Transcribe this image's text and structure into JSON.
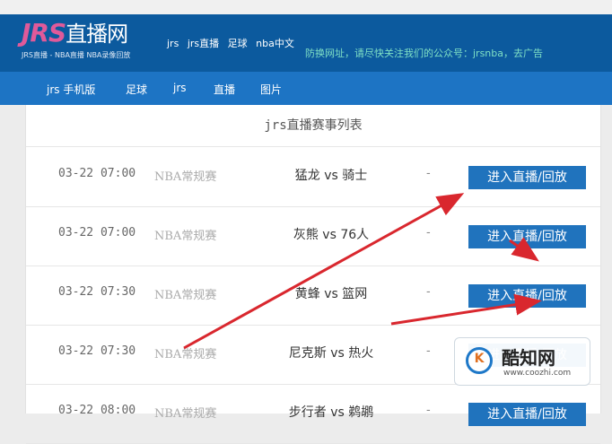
{
  "header": {
    "logo_jrs": "JRS",
    "logo_zh": "直播网",
    "logo_sub": "JRS直播 - NBA直播 NBA录像回放",
    "links": [
      "jrs",
      "jrs直播",
      "足球",
      "nba中文"
    ],
    "notice": "防换网址，请尽快关注我们的公众号：jrsnba，去广告"
  },
  "nav": {
    "items": [
      "jrs 手机版",
      "足球",
      "jrs",
      "直播",
      "图片"
    ]
  },
  "list": {
    "title": "jrs直播赛事列表",
    "button_label": "进入直播/回放",
    "rows": [
      {
        "time": "03-22 07:00",
        "league": "NBA常规赛",
        "match": "猛龙 vs 骑士",
        "score": "-"
      },
      {
        "time": "03-22 07:00",
        "league": "NBA常规赛",
        "match": "灰熊 vs 76人",
        "score": "-"
      },
      {
        "time": "03-22 07:30",
        "league": "NBA常规赛",
        "match": "黄蜂 vs 篮网",
        "score": "-"
      },
      {
        "time": "03-22 07:30",
        "league": "NBA常规赛",
        "match": "尼克斯 vs 热火",
        "score": "-"
      },
      {
        "time": "03-22 08:00",
        "league": "NBA常规赛",
        "match": "步行者 vs 鹈鹕",
        "score": "-"
      }
    ]
  },
  "watermark": {
    "letter": "K",
    "name": "酷知网",
    "url": "www.coozhi.com"
  },
  "colors": {
    "header_bg": "#0c5a9e",
    "nav_bg": "#1d74c4",
    "button_bg": "#2073bd",
    "arrow": "#d9272e"
  }
}
